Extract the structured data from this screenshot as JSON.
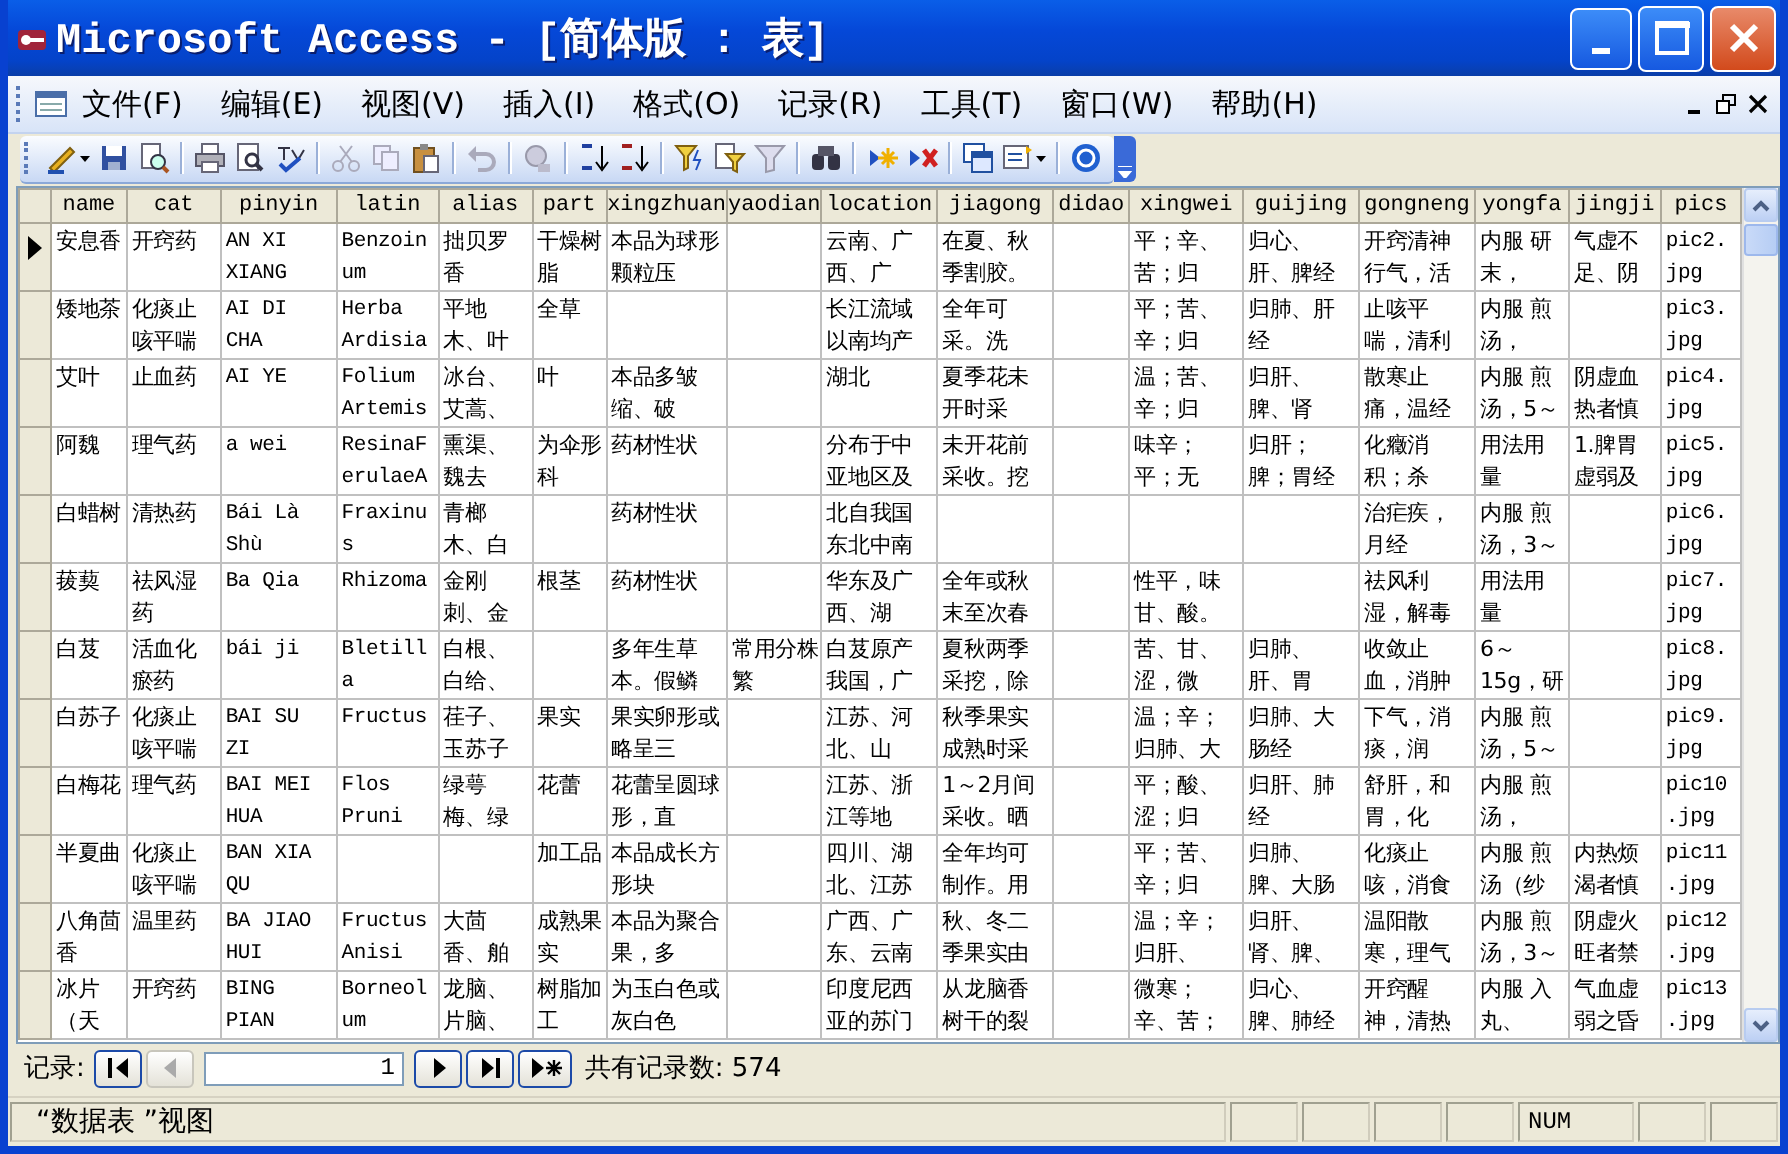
{
  "window": {
    "title": "Microsoft Access - [简体版 : 表]"
  },
  "menu": [
    "文件(F)",
    "编辑(E)",
    "视图(V)",
    "插入(I)",
    "格式(O)",
    "记录(R)",
    "工具(T)",
    "窗口(W)",
    "帮助(H)"
  ],
  "table": {
    "columns": [
      "name",
      "cat",
      "pinyin",
      "latin",
      "alias",
      "part",
      "xingzhuan",
      "yaodian",
      "location",
      "jiagong",
      "didao",
      "xingwei",
      "guijing",
      "gongneng",
      "yongfa",
      "jingji",
      "pics"
    ],
    "rows": [
      {
        "selected": true,
        "cells": [
          "安息香",
          "开窍药",
          "AN XI XIANG",
          "Benzoinum",
          "拙贝罗香",
          "干燥树脂",
          "本品为球形颗粒压",
          "",
          "云南、广西、广",
          "在夏、秋季割胶。",
          "",
          "平；辛、苦；归",
          "归心、肝、脾经",
          "开窍清神行气，活",
          "内服 研末，",
          "气虚不足、阴",
          "pic2.jpg"
        ]
      },
      {
        "selected": false,
        "cells": [
          "矮地茶",
          "化痰止咳平喘",
          "AI DI CHA",
          "Herba Ardisia",
          "平地木、叶",
          "全草",
          "",
          "",
          "长江流域以南均产",
          "全年可采。洗",
          "",
          "平；苦、辛；归",
          "归肺、肝经",
          "止咳平喘，清利",
          "内服 煎汤，",
          "",
          "pic3.jpg"
        ]
      },
      {
        "selected": false,
        "cells": [
          "艾叶",
          "止血药",
          "AI YE",
          "Folium Artemis",
          "冰台、艾蒿、",
          "叶",
          "本品多皱缩、破",
          "",
          "湖北",
          "夏季花未开时采",
          "",
          "温；苦、辛；归",
          "归肝、脾、肾",
          "散寒止痛，温经",
          "内服 煎汤，5～",
          "阴虚血热者慎",
          "pic4.jpg"
        ]
      },
      {
        "selected": false,
        "cells": [
          "阿魏",
          "理气药",
          "a wei",
          "ResinaFerulaeA",
          "熏渠、魏去",
          "为伞形科",
          "药材性状",
          "",
          "分布于中亚地区及",
          "未开花前采收。挖",
          "",
          "味辛；平；无",
          "归肝；脾；胃经",
          "化癥消积；杀",
          "用法用量",
          "1.脾胃虚弱及",
          "pic5.jpg"
        ]
      },
      {
        "selected": false,
        "cells": [
          "白蜡树",
          "清热药",
          "Bái Là Shù",
          "Fraxinus",
          "青榔木、白",
          "",
          "药材性状",
          "",
          "北自我国东北中南",
          "",
          "",
          "",
          "",
          "治疟疾，月经",
          "内服 煎汤，3～",
          "",
          "pic6.jpg"
        ]
      },
      {
        "selected": false,
        "cells": [
          "菝葜",
          "祛风湿药",
          "Ba Qia",
          "Rhizoma",
          "金刚刺、金",
          "根茎",
          "药材性状",
          "",
          "华东及广西、湖",
          "全年或秋末至次春",
          "",
          "性平，味甘、酸。",
          "",
          "祛风利湿，解毒",
          "用法用量",
          "",
          "pic7.jpg"
        ]
      },
      {
        "selected": false,
        "cells": [
          "白芨",
          "活血化瘀药",
          "bái ji",
          "Bletilla",
          "白根、白给、",
          "",
          "多年生草本。假鳞",
          "常用分株繁",
          "白芨原产我国，广",
          "夏秋两季采挖，除",
          "",
          "苦、甘、涩，微",
          "归肺、肝、胃",
          "收敛止血，消肿",
          "6～15g，研",
          "",
          "pic8.jpg"
        ]
      },
      {
        "selected": false,
        "cells": [
          "白苏子",
          "化痰止咳平喘",
          "BAI SU ZI",
          "Fructus",
          "荏子、玉苏子",
          "果实",
          "果实卵形或略呈三",
          "",
          "江苏、河北、山",
          "秋季果实成熟时采",
          "",
          "温；辛；归肺、大",
          "归肺、大肠经",
          "下气，消痰，润",
          "内服 煎汤，5～",
          "",
          "pic9.jpg"
        ]
      },
      {
        "selected": false,
        "cells": [
          "白梅花",
          "理气药",
          "BAI MEI HUA",
          "Flos Pruni",
          "绿萼梅、绿",
          "花蕾",
          "花蕾呈圆球形，直",
          "",
          "江苏、浙江等地",
          "1～2月间采收。晒",
          "",
          "平；酸、涩；归",
          "归肝、肺经",
          "舒肝，和胃，化",
          "内服 煎汤，",
          "",
          "pic10.jpg"
        ]
      },
      {
        "selected": false,
        "cells": [
          "半夏曲",
          "化痰止咳平喘",
          "BAN XIA QU",
          "",
          "",
          "加工品",
          "本品成长方形块",
          "",
          "四川、湖北、江苏",
          "全年均可制作。用",
          "",
          "平；苦、辛；归",
          "归肺、脾、大肠",
          "化痰止咳，消食",
          "内服 煎汤（纱",
          "内热烦渴者慎",
          "pic11.jpg"
        ]
      },
      {
        "selected": false,
        "cells": [
          "八角茴香",
          "温里药",
          "BA JIAO HUI",
          "Fructus Anisi",
          "大茴香、舶",
          "成熟果实",
          "本品为聚合果，多",
          "",
          "广西、广东、云南",
          "秋、冬二季果实由",
          "",
          "温；辛；归肝、",
          "归肝、肾、脾、",
          "温阳散寒，理气",
          "内服 煎汤，3～",
          "阴虚火旺者禁",
          "pic12.jpg"
        ]
      },
      {
        "selected": false,
        "cells": [
          "冰片（天",
          "开窍药",
          "BING PIAN",
          "Borneolum",
          "龙脑、片脑、",
          "树脂加工",
          "为玉白色或灰白色",
          "",
          "印度尼西亚的苏门",
          "从龙脑香树干的裂",
          "",
          "微寒；辛、苦；",
          "归心、脾、肺经",
          "开窍醒神，清热",
          "内服 入丸、",
          "气血虚弱之昏",
          "pic13.jpg"
        ]
      }
    ]
  },
  "navigation": {
    "label": "记录:",
    "buttons": [
      {
        "kind": "first",
        "disabled": false
      },
      {
        "kind": "prev",
        "disabled": true
      }
    ],
    "current": "1",
    "buttons_after": [
      {
        "kind": "next",
        "disabled": false
      },
      {
        "kind": "last",
        "disabled": false
      },
      {
        "kind": "new",
        "disabled": false
      }
    ],
    "total": "共有记录数: 574"
  },
  "status_bar": {
    "text": "“数据表 ”视图",
    "indicator": "NUM"
  }
}
